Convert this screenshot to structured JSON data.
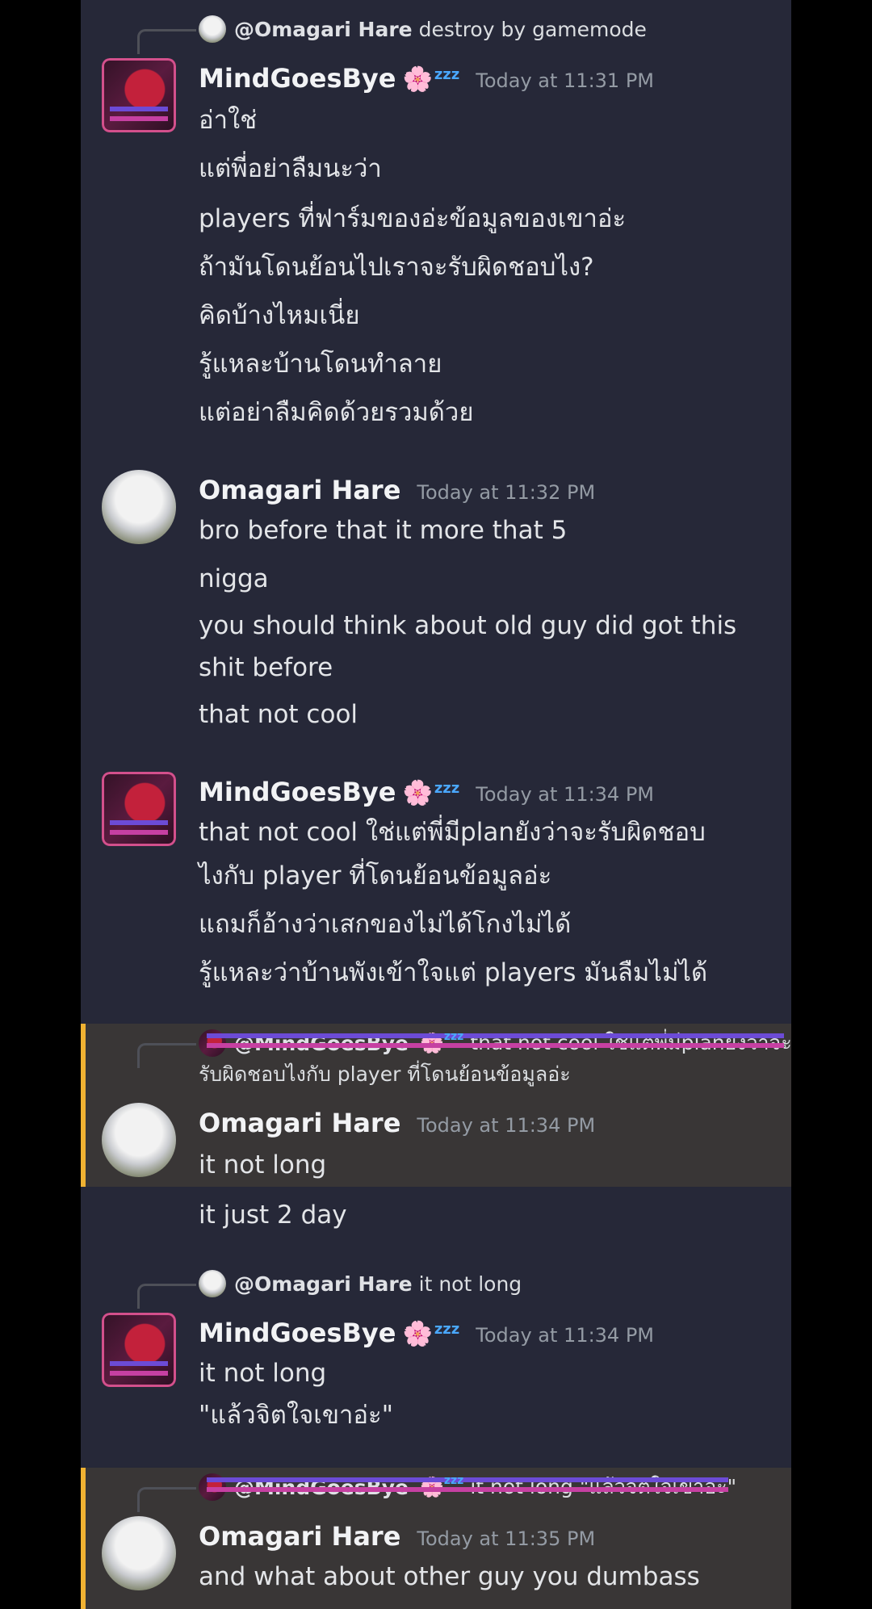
{
  "messages": [
    {
      "reply": {
        "name": "@Omagari Hare",
        "text": "destroy by gamemode"
      },
      "author": "MindGoesBye",
      "badge": "🌸",
      "status": "zzz",
      "time": "Today at 11:31 PM",
      "lines": [
        "อ่าใช่",
        "แต่พี่อย่าลืมนะว่า",
        "players ที่ฟาร์มของอ่ะข้อมูลของเขาอ่ะ",
        "ถ้ามันโดนย้อนไปเราจะรับผิดชอบไง?",
        "คิดบ้างไหมเนี่ย",
        "รู้แหละบ้านโดนทำลาย",
        "แต่อย่าลืมคิดด้วยรวมด้วย"
      ]
    },
    {
      "author": "Omagari Hare",
      "time": "Today at 11:32 PM",
      "lines": [
        "bro before that it more that 5",
        "nigga",
        "you should think about old guy did got this",
        "shit before",
        "that not cool"
      ]
    },
    {
      "author": "MindGoesBye",
      "badge": "🌸",
      "status": "zzz",
      "time": "Today at 11:34 PM",
      "lines": [
        "that not cool ใช่แต่พี่มีplanยังว่าจะรับผิดชอบ",
        "ไงกับ player ที่โดนย้อนข้อมูลอ่ะ",
        "แถมก็อ้างว่าเสกของไม่ได้โกงไม่ได้",
        "รู้แหละว่าบ้านพังเข้าใจแต่ players มันลืมไม่ได้"
      ]
    },
    {
      "reply": {
        "name": "@MindGoesBye",
        "badge": "🌸",
        "status": "zzz",
        "text": "that not cool ใช่แต่พี่มีplanยังว่าจะ",
        "text2": "รับผิดชอบไงกับ player ที่โดนย้อนข้อมูลอ่ะ"
      },
      "author": "Omagari Hare",
      "time": "Today at 11:34 PM",
      "lines": [
        "it not long"
      ],
      "followup": [
        "it just 2 day"
      ]
    },
    {
      "reply": {
        "name": "@Omagari Hare",
        "text": "it not long"
      },
      "author": "MindGoesBye",
      "badge": "🌸",
      "status": "zzz",
      "time": "Today at 11:34 PM",
      "lines": [
        "it not long",
        "\"แล้วจิตใจเขาอ่ะ\""
      ]
    },
    {
      "reply": {
        "name": "@MindGoesBye",
        "badge": "🌸",
        "status": "zzz",
        "text": "it not long  \"แล้วจิตใจเขาอ่ะ\""
      },
      "author": "Omagari Hare",
      "time": "Today at 11:35 PM",
      "lines": [
        "and what about other guy you dumbass"
      ]
    }
  ]
}
